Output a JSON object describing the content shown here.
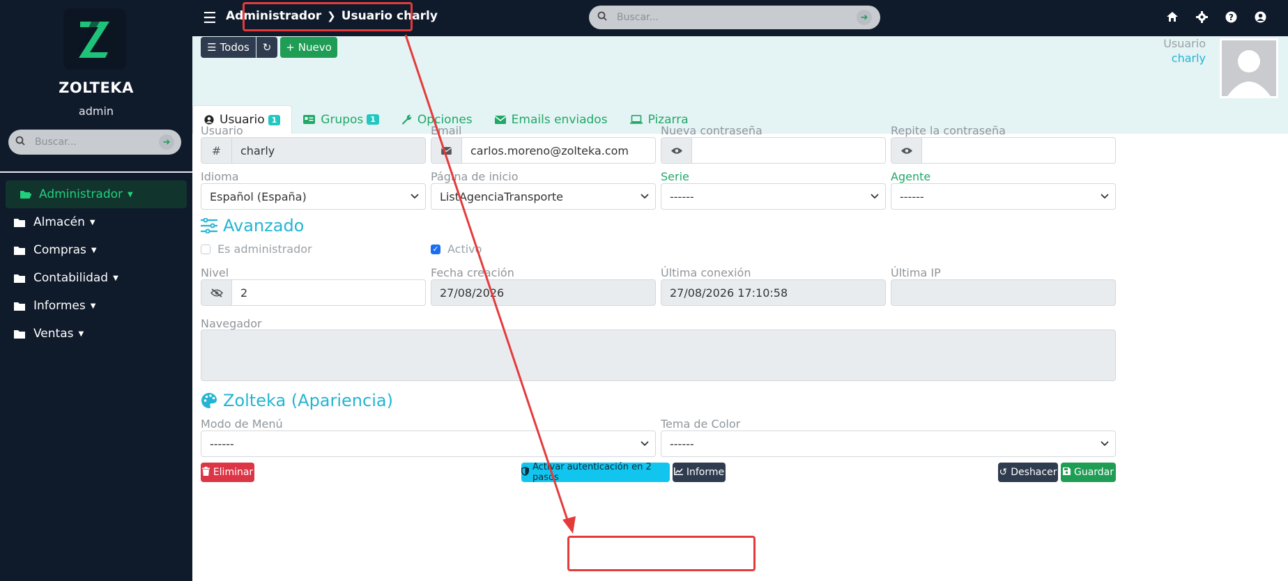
{
  "sidebar": {
    "brand": "ZOLTEKA",
    "user": "admin",
    "search_placeholder": "Buscar...",
    "items": [
      {
        "label": "Administrador",
        "active": true
      },
      {
        "label": "Almacén"
      },
      {
        "label": "Compras"
      },
      {
        "label": "Contabilidad"
      },
      {
        "label": "Informes"
      },
      {
        "label": "Ventas"
      }
    ]
  },
  "topbar": {
    "breadcrumb": {
      "parent": "Administrador",
      "current": "Usuario charly"
    },
    "search_placeholder": "Buscar..."
  },
  "toolbar": {
    "all_label": "Todos",
    "new_label": "Nuevo"
  },
  "header_user": {
    "label": "Usuario",
    "name": "charly"
  },
  "tabs": [
    {
      "label": "Usuario",
      "badge": "1"
    },
    {
      "label": "Grupos",
      "badge": "1"
    },
    {
      "label": "Opciones"
    },
    {
      "label": "Emails enviados"
    },
    {
      "label": "Pizarra"
    }
  ],
  "form": {
    "usuario": {
      "label": "Usuario",
      "value": "charly"
    },
    "email": {
      "label": "Email",
      "value": "carlos.moreno@zolteka.com"
    },
    "nueva": {
      "label": "Nueva contraseña",
      "value": ""
    },
    "repite": {
      "label": "Repite la contraseña",
      "value": ""
    },
    "idioma": {
      "label": "Idioma",
      "value": "Español (España)"
    },
    "inicio": {
      "label": "Página de inicio",
      "value": "ListAgenciaTransporte"
    },
    "serie": {
      "label": "Serie",
      "value": "------"
    },
    "agente": {
      "label": "Agente",
      "value": "------"
    },
    "avanzado_title": "Avanzado",
    "es_admin": {
      "label": "Es administrador",
      "checked": false
    },
    "activo": {
      "label": "Activo",
      "checked": true
    },
    "nivel": {
      "label": "Nivel",
      "value": "2"
    },
    "fecha": {
      "label": "Fecha creación",
      "value": "27/08/2026"
    },
    "ultima_conexion": {
      "label": "Última conexión",
      "value": "27/08/2026 17:10:58"
    },
    "ultima_ip": {
      "label": "Última IP",
      "value": ""
    },
    "navegador": {
      "label": "Navegador",
      "value": ""
    },
    "apariencia_title": "Zolteka (Apariencia)",
    "modo_menu": {
      "label": "Modo de Menú",
      "value": "------"
    },
    "tema": {
      "label": "Tema de Color",
      "value": "------"
    }
  },
  "actions": {
    "delete": "Eliminar",
    "twofa": "Activar autenticación en 2 pasos",
    "report": "Informe",
    "undo": "Deshacer",
    "save": "Guardar"
  },
  "colors": {
    "sidebar_bg": "#0f1a2b",
    "accent_green": "#1fa867",
    "accent_teal": "#23b5d3",
    "annotation_red": "#e53a3a"
  }
}
